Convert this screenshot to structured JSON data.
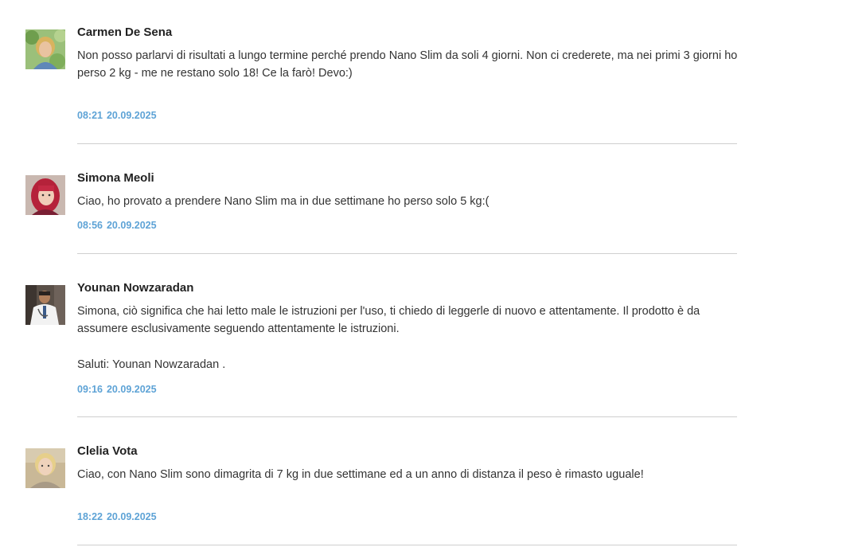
{
  "comments": [
    {
      "name": "Carmen De Sena",
      "text": [
        "Non posso parlarvi di risultati a lungo termine perché prendo Nano Slim da soli 4 giorni. Non ci crederete, ma nei primi 3 giorni ho perso 2 kg - me ne restano solo 18! Ce la farò! Devo:)"
      ],
      "time": "08:21",
      "date": "20.09.2025",
      "avatar_icon": "woman-blonde-outdoor-avatar"
    },
    {
      "name": "Simona Meoli",
      "text": [
        "Ciao, ho provato a prendere Nano Slim ma in due settimane ho perso solo 5 kg:("
      ],
      "time": "08:56",
      "date": "20.09.2025",
      "avatar_icon": "woman-red-hair-avatar"
    },
    {
      "name": "Younan Nowzaradan",
      "text": [
        "Simona, ciò significa che hai letto male le istruzioni per l'uso, ti chiedo di leggerle di nuovo e attentamente. Il prodotto è da assumere esclusivamente seguendo attentamente le istruzioni.",
        "Saluti: Younan Nowzaradan ."
      ],
      "time": "09:16",
      "date": "20.09.2025",
      "avatar_icon": "doctor-white-coat-avatar"
    },
    {
      "name": "Clelia Vota",
      "text": [
        "Ciao, con Nano Slim sono dimagrita di 7 kg in due settimane ed a un anno di distanza il peso è rimasto uguale!"
      ],
      "time": "18:22",
      "date": "20.09.2025",
      "avatar_icon": "woman-short-blonde-avatar"
    }
  ],
  "colors": {
    "timestamp": "#5ea3d6",
    "divider": "#cfcfcf",
    "name": "#222222",
    "text": "#333333"
  }
}
